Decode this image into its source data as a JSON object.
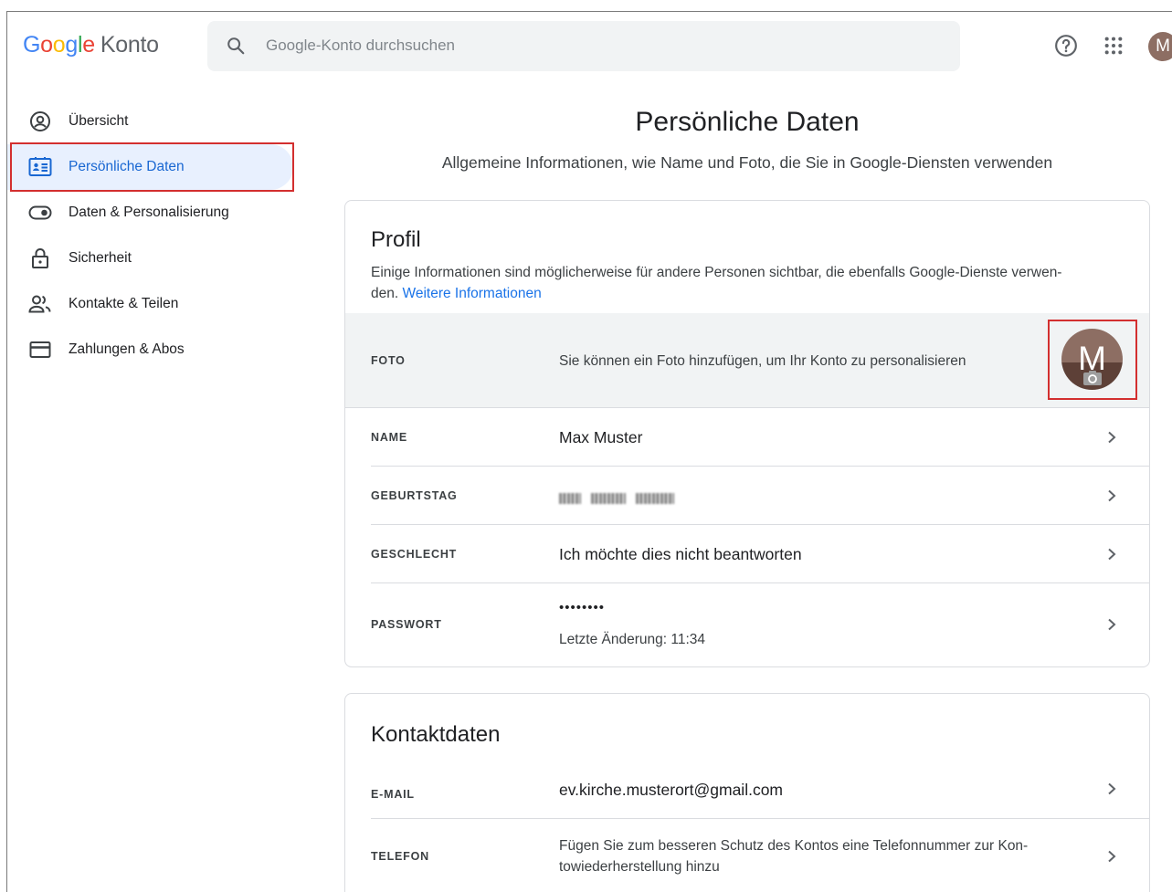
{
  "header": {
    "logo_letters": [
      "G",
      "o",
      "o",
      "g",
      "l",
      "e"
    ],
    "logo_product": "Konto",
    "search_placeholder": "Google-Konto durchsuchen",
    "avatar_letter": "M"
  },
  "sidebar": {
    "items": [
      {
        "label": "Übersicht",
        "icon": "account-circle-icon"
      },
      {
        "label": "Persönliche Daten",
        "icon": "id-card-icon",
        "active": true
      },
      {
        "label": "Daten & Personalisierung",
        "icon": "toggle-icon"
      },
      {
        "label": "Sicherheit",
        "icon": "lock-icon"
      },
      {
        "label": "Kontakte & Teilen",
        "icon": "people-icon"
      },
      {
        "label": "Zahlungen & Abos",
        "icon": "credit-card-icon"
      }
    ]
  },
  "main": {
    "title": "Persönliche Daten",
    "subtitle": "Allgemeine Informationen, wie Name und Foto, die Sie in Google-Diensten verwenden"
  },
  "profile": {
    "title": "Profil",
    "desc_line1": "Einige Informationen sind möglicherweise für andere Personen sichtbar, die ebenfalls Google-Dienste verwen-",
    "desc_line2": "den.",
    "more_link": "Weitere Informationen",
    "foto_label": "FOTO",
    "foto_text": "Sie können ein Foto hinzufügen, um Ihr Konto zu personalisieren",
    "foto_avatar_letter": "M",
    "name_label": "NAME",
    "name_value": "Max Muster",
    "birthday_label": "GEBURTSTAG",
    "gender_label": "GESCHLECHT",
    "gender_value": "Ich möchte dies nicht beantworten",
    "password_label": "PASSWORT",
    "password_value": "••••••••",
    "password_changed": "Letzte Änderung: 11:34"
  },
  "contact": {
    "title": "Kontaktdaten",
    "email_label": "E-MAIL",
    "email_value": "ev.kirche.musterort@gmail.com",
    "phone_label": "TELEFON",
    "phone_line1": "Fügen Sie zum besseren Schutz des Kontos eine Telefonnummer zur Kon-",
    "phone_line2": "towiederherstellung hinzu"
  },
  "colors": {
    "accent": "#1a73e8",
    "active_bg": "#e8f0fe",
    "highlight_box": "#d32f2f",
    "avatar": "#8d6e63"
  }
}
